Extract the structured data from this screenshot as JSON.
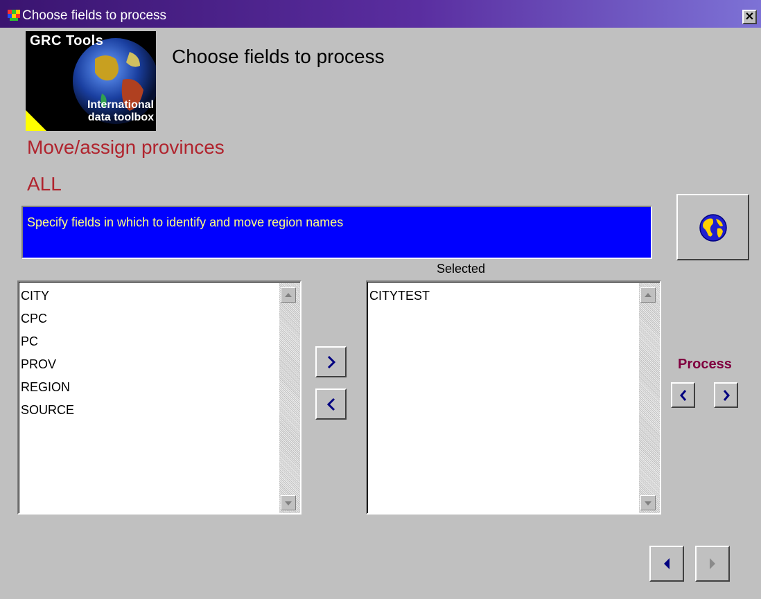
{
  "window": {
    "title": "Choose fields to process",
    "close_glyph": "✕"
  },
  "logo": {
    "line1": "GRC Tools",
    "line2": "International",
    "line3": "data toolbox"
  },
  "header": {
    "title": "Choose fields to process"
  },
  "task": {
    "name": "Move/assign provinces",
    "scope": "ALL"
  },
  "instruction": "Specify fields in which to identify and move region names",
  "available_list": {
    "items": [
      "CITY",
      "CPC",
      "PC",
      "PROV",
      "REGION",
      "SOURCE"
    ]
  },
  "selected_list": {
    "label": "Selected",
    "items": [
      "CITYTEST"
    ]
  },
  "process": {
    "label": "Process"
  },
  "colors": {
    "title_bar_start": "#3a1470",
    "title_bar_end": "#7d72d6",
    "instruction_bg": "#0000ff",
    "instruction_text": "#ffff80",
    "task_text": "#b0242e",
    "process_text": "#800040",
    "arrow": "#000080"
  },
  "icons": [
    "app-icon",
    "close-icon",
    "globe-icon",
    "chevron-right-icon",
    "chevron-left-icon",
    "triangle-left-icon",
    "triangle-right-icon",
    "scroll-up-icon",
    "scroll-down-icon"
  ]
}
